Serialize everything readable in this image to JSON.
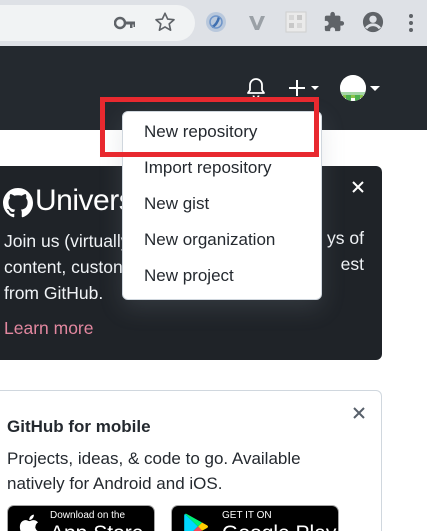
{
  "browser": {
    "key_icon": "key-icon",
    "bookmark_icon": "star-icon",
    "extensions": [
      "extension-icon",
      "vimeo-extension-icon",
      "extension-icon"
    ],
    "menu_icon": "kebab-menu-icon"
  },
  "header": {
    "notifications_icon": "bell-icon",
    "create_icon": "plus-icon",
    "avatar_icon": "avatar-icon"
  },
  "create_menu": {
    "items": [
      {
        "label": "New repository"
      },
      {
        "label": "Import repository"
      },
      {
        "label": "New gist"
      },
      {
        "label": "New organization"
      },
      {
        "label": "New project"
      }
    ],
    "highlight_color": "#e8292f"
  },
  "promo": {
    "title": "Univers",
    "lines": [
      "Join us (virtually",
      "content, custon",
      "from GitHub."
    ],
    "lines_right": [
      "ys of",
      "est"
    ],
    "link_label": "Learn more",
    "link_color": "#e2879f"
  },
  "mobile": {
    "title": "GitHub for mobile",
    "text": "Projects, ideas, & code to go. Available natively for Android and iOS.",
    "appstore": {
      "small": "Download on the",
      "big": "App Store"
    },
    "playstore": {
      "small": "GET IT ON",
      "big": "Google Play"
    }
  }
}
